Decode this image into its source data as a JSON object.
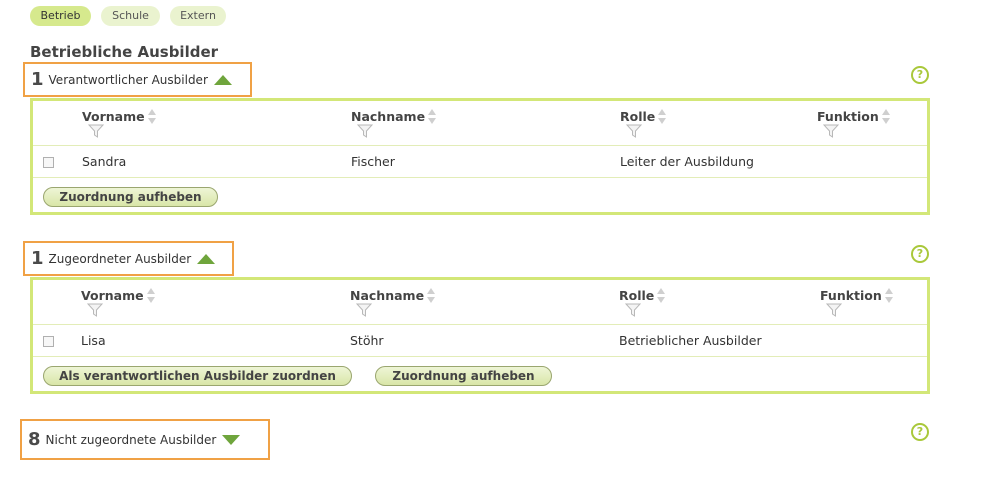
{
  "tabs": [
    {
      "label": "Betrieb",
      "active": true
    },
    {
      "label": "Schule",
      "active": false
    },
    {
      "label": "Extern",
      "active": false
    }
  ],
  "section_title": "Betriebliche Ausbilder",
  "groups": [
    {
      "count": "1",
      "label": "Verantwortlicher Ausbilder",
      "expanded": true,
      "help": "?",
      "columns": [
        "Vorname",
        "Nachname",
        "Rolle",
        "Funktion"
      ],
      "rows": [
        {
          "vorname": "Sandra",
          "nachname": "Fischer",
          "rolle": "Leiter der Ausbildung",
          "funktion": ""
        }
      ],
      "buttons": [
        "Zuordnung aufheben"
      ]
    },
    {
      "count": "1",
      "label": "Zugeordneter Ausbilder",
      "expanded": true,
      "help": "?",
      "columns": [
        "Vorname",
        "Nachname",
        "Rolle",
        "Funktion"
      ],
      "rows": [
        {
          "vorname": "Lisa",
          "nachname": "Stöhr",
          "rolle": "Betrieblicher Ausbilder",
          "funktion": ""
        }
      ],
      "buttons": [
        "Als verantwortlichen Ausbilder zuordnen",
        "Zuordnung aufheben"
      ]
    },
    {
      "count": "8",
      "label": "Nicht zugeordnete Ausbilder",
      "expanded": false,
      "help": "?"
    }
  ],
  "colors": {
    "accent_green": "#d3e778",
    "header_highlight": "#f0a145",
    "toggle_green": "#6fa53c"
  }
}
